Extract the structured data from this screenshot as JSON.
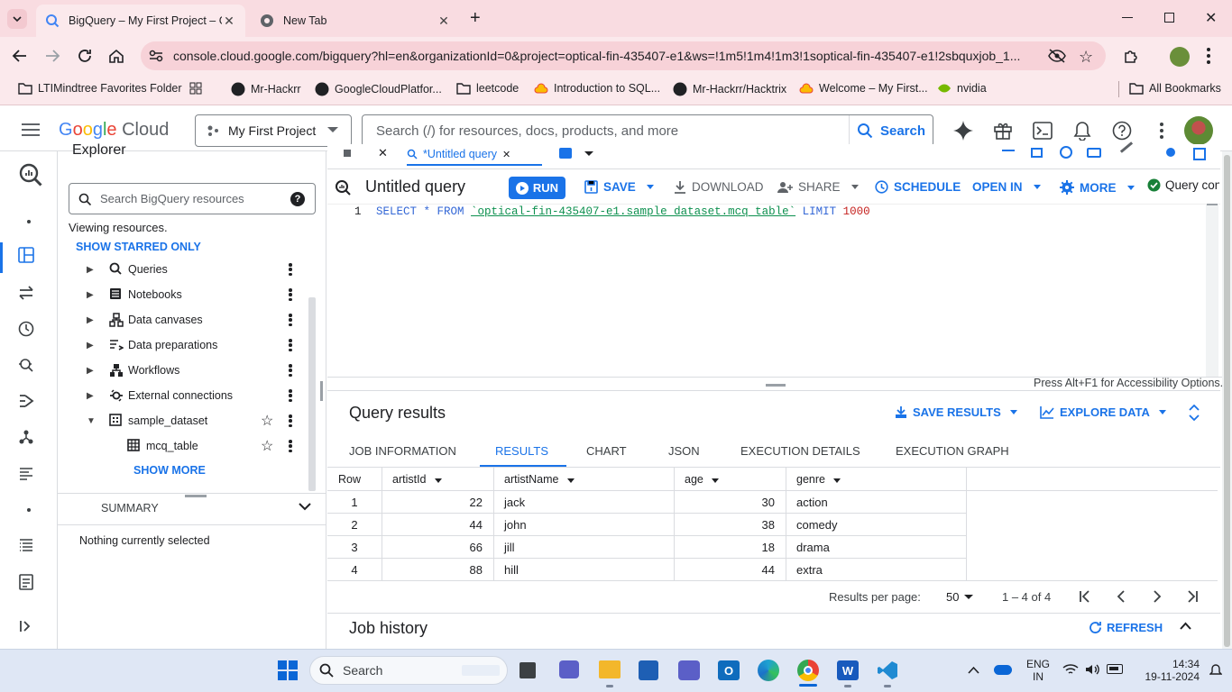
{
  "browser": {
    "tabs": [
      {
        "title": "BigQuery – My First Project – G"
      },
      {
        "title": "New Tab"
      }
    ],
    "url_host": "console.cloud.google.com",
    "url_path": "/bigquery?hl=en&organizationId=0&project=optical-fin-435407-e1&ws=!1m5!1m4!1m3!1soptical-fin-435407-e1!2sbquxjob_1...",
    "bookmarks": [
      "LTIMindtree Favorites Folder",
      "Mr-Hackrr",
      "GoogleCloudPlatfor...",
      "leetcode",
      "Introduction to SQL...",
      "Mr-Hackrr/Hacktrix",
      "Welcome – My First...",
      "nvidia"
    ],
    "all_bookmarks": "All Bookmarks"
  },
  "gc": {
    "logo": "Google Cloud",
    "project": "My First Project",
    "search_placeholder": "Search (/) for resources, docs, products, and more",
    "search_button": "Search"
  },
  "explorer": {
    "title": "Explorer",
    "search_placeholder": "Search BigQuery resources",
    "viewing": "Viewing resources.",
    "starred": "SHOW STARRED ONLY",
    "items": [
      {
        "label": "Queries"
      },
      {
        "label": "Notebooks"
      },
      {
        "label": "Data canvases"
      },
      {
        "label": "Data preparations"
      },
      {
        "label": "Workflows"
      },
      {
        "label": "External connections"
      },
      {
        "label": "sample_dataset"
      },
      {
        "label": "mcq_table"
      }
    ],
    "show_more": "SHOW MORE",
    "summary": "SUMMARY",
    "nothing": "Nothing currently selected"
  },
  "editor": {
    "tab_label": "*Untitled query",
    "title": "Untitled query",
    "run": "RUN",
    "save": "SAVE",
    "download": "DOWNLOAD",
    "share": "SHARE",
    "schedule": "SCHEDULE",
    "open_in": "OPEN IN",
    "more": "MORE",
    "status": "Query con",
    "line_no": "1",
    "code_kw1": "SELECT * FROM ",
    "code_table": "`optical-fin-435407-e1.sample_dataset.mcq_table`",
    "code_kw2": " LIMIT ",
    "code_num": "1000",
    "accessibility": "Press Alt+F1 for Accessibility Options."
  },
  "results": {
    "title": "Query results",
    "save_results": "SAVE RESULTS",
    "explore_data": "EXPLORE DATA",
    "tabs": [
      "JOB INFORMATION",
      "RESULTS",
      "CHART",
      "JSON",
      "EXECUTION DETAILS",
      "EXECUTION GRAPH"
    ],
    "columns": [
      "Row",
      "artistId",
      "artistName",
      "age",
      "genre"
    ],
    "rows": [
      [
        "1",
        "22",
        "jack",
        "30",
        "action"
      ],
      [
        "2",
        "44",
        "john",
        "38",
        "comedy"
      ],
      [
        "3",
        "66",
        "jill",
        "18",
        "drama"
      ],
      [
        "4",
        "88",
        "hill",
        "44",
        "extra"
      ]
    ],
    "per_page_label": "Results per page:",
    "per_page": "50",
    "range": "1 – 4 of 4"
  },
  "job_history": {
    "title": "Job history",
    "refresh": "REFRESH"
  },
  "taskbar": {
    "search": "Search",
    "lang1": "ENG",
    "lang2": "IN",
    "time": "14:34",
    "date": "19-11-2024"
  },
  "colors": {
    "accent": "#1a73e8",
    "run": "#1a73e8",
    "tabstrip": "#f9dce1"
  }
}
